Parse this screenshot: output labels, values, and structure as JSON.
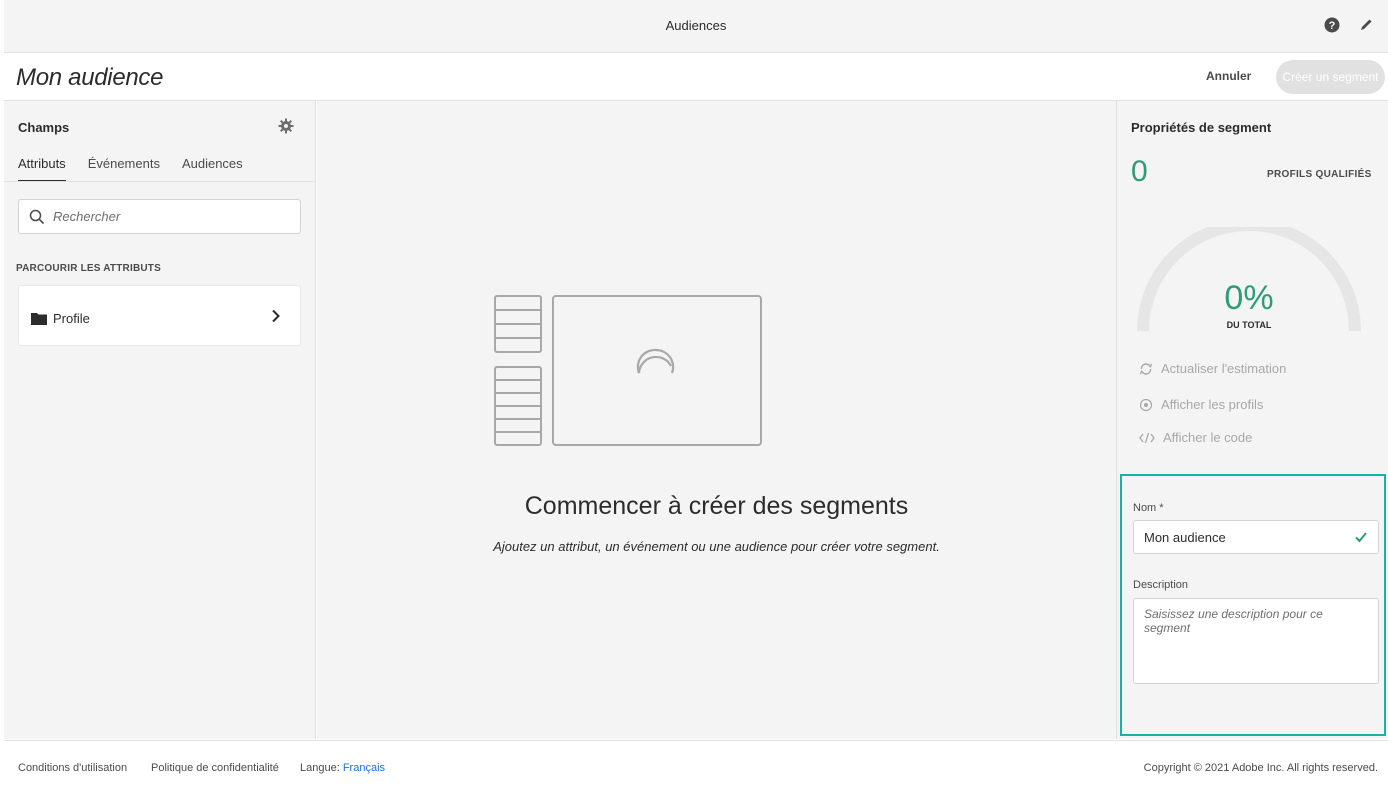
{
  "topbar": {
    "title": "Audiences",
    "help_icon": "help-circle-icon",
    "edit_icon": "pencil-icon"
  },
  "header": {
    "page_title": "Mon audience",
    "cancel_label": "Annuler",
    "create_label": "Créer un segment"
  },
  "left_panel": {
    "title": "Champs",
    "tabs": [
      {
        "label": "Attributs",
        "active": true
      },
      {
        "label": "Événements",
        "active": false
      },
      {
        "label": "Audiences",
        "active": false
      }
    ],
    "search": {
      "placeholder": "Rechercher",
      "value": ""
    },
    "browse_label": "PARCOURIR LES ATTRIBUTS",
    "items": [
      {
        "label": "Profile",
        "icon": "folder-icon"
      }
    ]
  },
  "center": {
    "title": "Commencer à créer des segments",
    "subtitle": "Ajoutez un attribut, un événement ou une audience pour créer votre segment."
  },
  "right_panel": {
    "title": "Propriétés de segment",
    "count": "0",
    "count_label": "PROFILS QUALIFIÉS",
    "percent": "0%",
    "percent_fraction": 0,
    "percent_label": "DU TOTAL",
    "actions": [
      {
        "label": "Actualiser l'estimation",
        "icon": "refresh-icon"
      },
      {
        "label": "Afficher les profils",
        "icon": "eye-icon"
      },
      {
        "label": "Afficher le code",
        "icon": "code-icon"
      }
    ],
    "form": {
      "name_label": "Nom *",
      "name_value": "Mon audience",
      "description_label": "Description",
      "description_placeholder": "Saisissez une description pour ce segment"
    }
  },
  "footer": {
    "terms": "Conditions d'utilisation",
    "privacy": "Politique de confidentialité",
    "language_label": "Langue:",
    "language_value": "Français",
    "copyright": "Copyright © 2021 Adobe Inc. All rights reserved."
  },
  "colors": {
    "accent_green": "#2d9d78",
    "highlight_border": "#19b2a8",
    "link_blue": "#1473e6"
  }
}
